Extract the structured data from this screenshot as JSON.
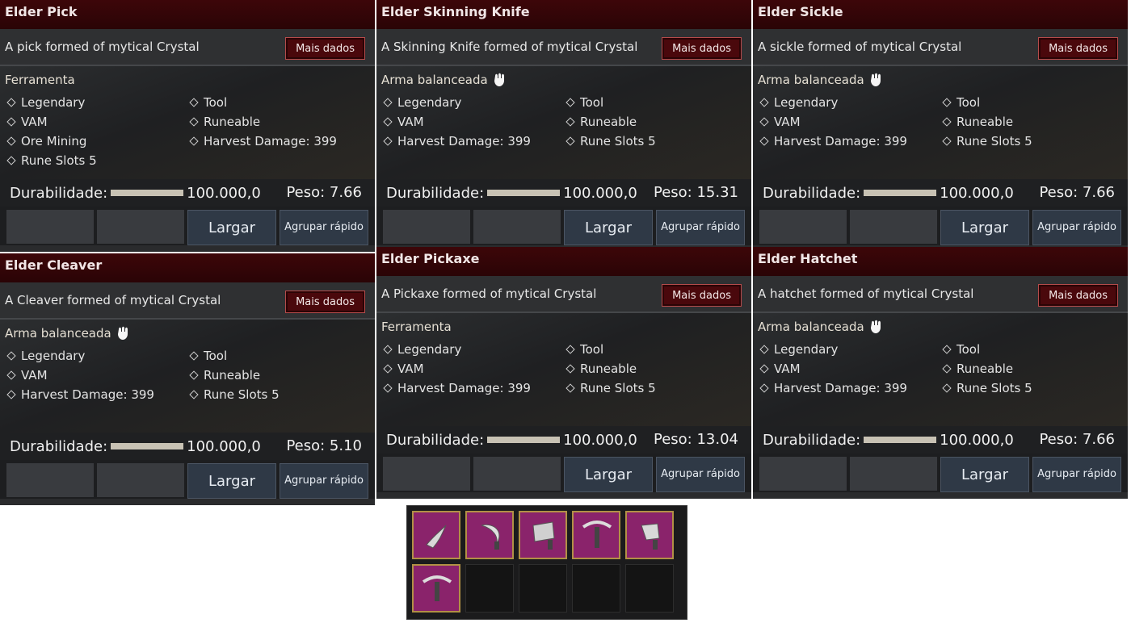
{
  "cards": [
    {
      "title": "Elder Pick",
      "description": "A pick formed of mytical Crystal",
      "more_label": "Mais dados",
      "category": "Ferramenta",
      "category_icon": "",
      "props": [
        "Legendary",
        "Tool",
        "VAM",
        "Runeable",
        "Ore Mining",
        "Harvest Damage: 399",
        "Rune Slots 5"
      ],
      "durability_label": "Durabilidade:",
      "durability_value": "100.000,0",
      "weight": "Peso: 7.66",
      "drop_label": "Largar",
      "quick_group_label": "Agrupar rápido"
    },
    {
      "title": "Elder Skinning Knife",
      "description": "A Skinning Knife formed of mytical Crystal",
      "more_label": "Mais dados",
      "category": "Arma balanceada",
      "category_icon": "fist-icon",
      "props": [
        "Legendary",
        "Tool",
        "VAM",
        "Runeable",
        "Harvest Damage: 399",
        "Rune Slots 5"
      ],
      "durability_label": "Durabilidade:",
      "durability_value": "100.000,0",
      "weight": "Peso: 15.31",
      "drop_label": "Largar",
      "quick_group_label": "Agrupar rápido"
    },
    {
      "title": "Elder Sickle",
      "description": "A sickle formed of mytical Crystal",
      "more_label": "Mais dados",
      "category": "Arma balanceada",
      "category_icon": "fist-icon",
      "props": [
        "Legendary",
        "Tool",
        "VAM",
        "Runeable",
        "Harvest Damage: 399",
        "Rune Slots 5"
      ],
      "durability_label": "Durabilidade:",
      "durability_value": "100.000,0",
      "weight": "Peso: 7.66",
      "drop_label": "Largar",
      "quick_group_label": "Agrupar rápido"
    },
    {
      "title": "Elder Cleaver",
      "description": "A Cleaver formed of mytical Crystal",
      "more_label": "Mais dados",
      "category": "Arma balanceada",
      "category_icon": "fist-icon",
      "props": [
        "Legendary",
        "Tool",
        "VAM",
        "Runeable",
        "Harvest Damage: 399",
        "Rune Slots 5"
      ],
      "durability_label": "Durabilidade:",
      "durability_value": "100.000,0",
      "weight": "Peso: 5.10",
      "drop_label": "Largar",
      "quick_group_label": "Agrupar rápido"
    },
    {
      "title": "Elder Pickaxe",
      "description": "A Pickaxe formed of mytical Crystal",
      "more_label": "Mais dados",
      "category": "Ferramenta",
      "category_icon": "",
      "props": [
        "Legendary",
        "Tool",
        "VAM",
        "Runeable",
        "Harvest Damage: 399",
        "Rune Slots 5"
      ],
      "durability_label": "Durabilidade:",
      "durability_value": "100.000,0",
      "weight": "Peso: 13.04",
      "drop_label": "Largar",
      "quick_group_label": "Agrupar rápido"
    },
    {
      "title": "Elder Hatchet",
      "description": "A hatchet formed of mytical Crystal",
      "more_label": "Mais dados",
      "category": "Arma balanceada",
      "category_icon": "fist-icon",
      "props": [
        "Legendary",
        "Tool",
        "VAM",
        "Runeable",
        "Harvest Damage: 399",
        "Rune Slots 5"
      ],
      "durability_label": "Durabilidade:",
      "durability_value": "100.000,0",
      "weight": "Peso: 7.66",
      "drop_label": "Largar",
      "quick_group_label": "Agrupar rápido"
    }
  ],
  "inventory": {
    "slots": [
      {
        "item": "skinning-knife-icon"
      },
      {
        "item": "sickle-icon"
      },
      {
        "item": "cleaver-icon"
      },
      {
        "item": "pickaxe-icon"
      },
      {
        "item": "hatchet-icon"
      },
      {
        "item": "pick-icon"
      },
      {
        "item": ""
      },
      {
        "item": ""
      },
      {
        "item": ""
      },
      {
        "item": ""
      }
    ]
  }
}
